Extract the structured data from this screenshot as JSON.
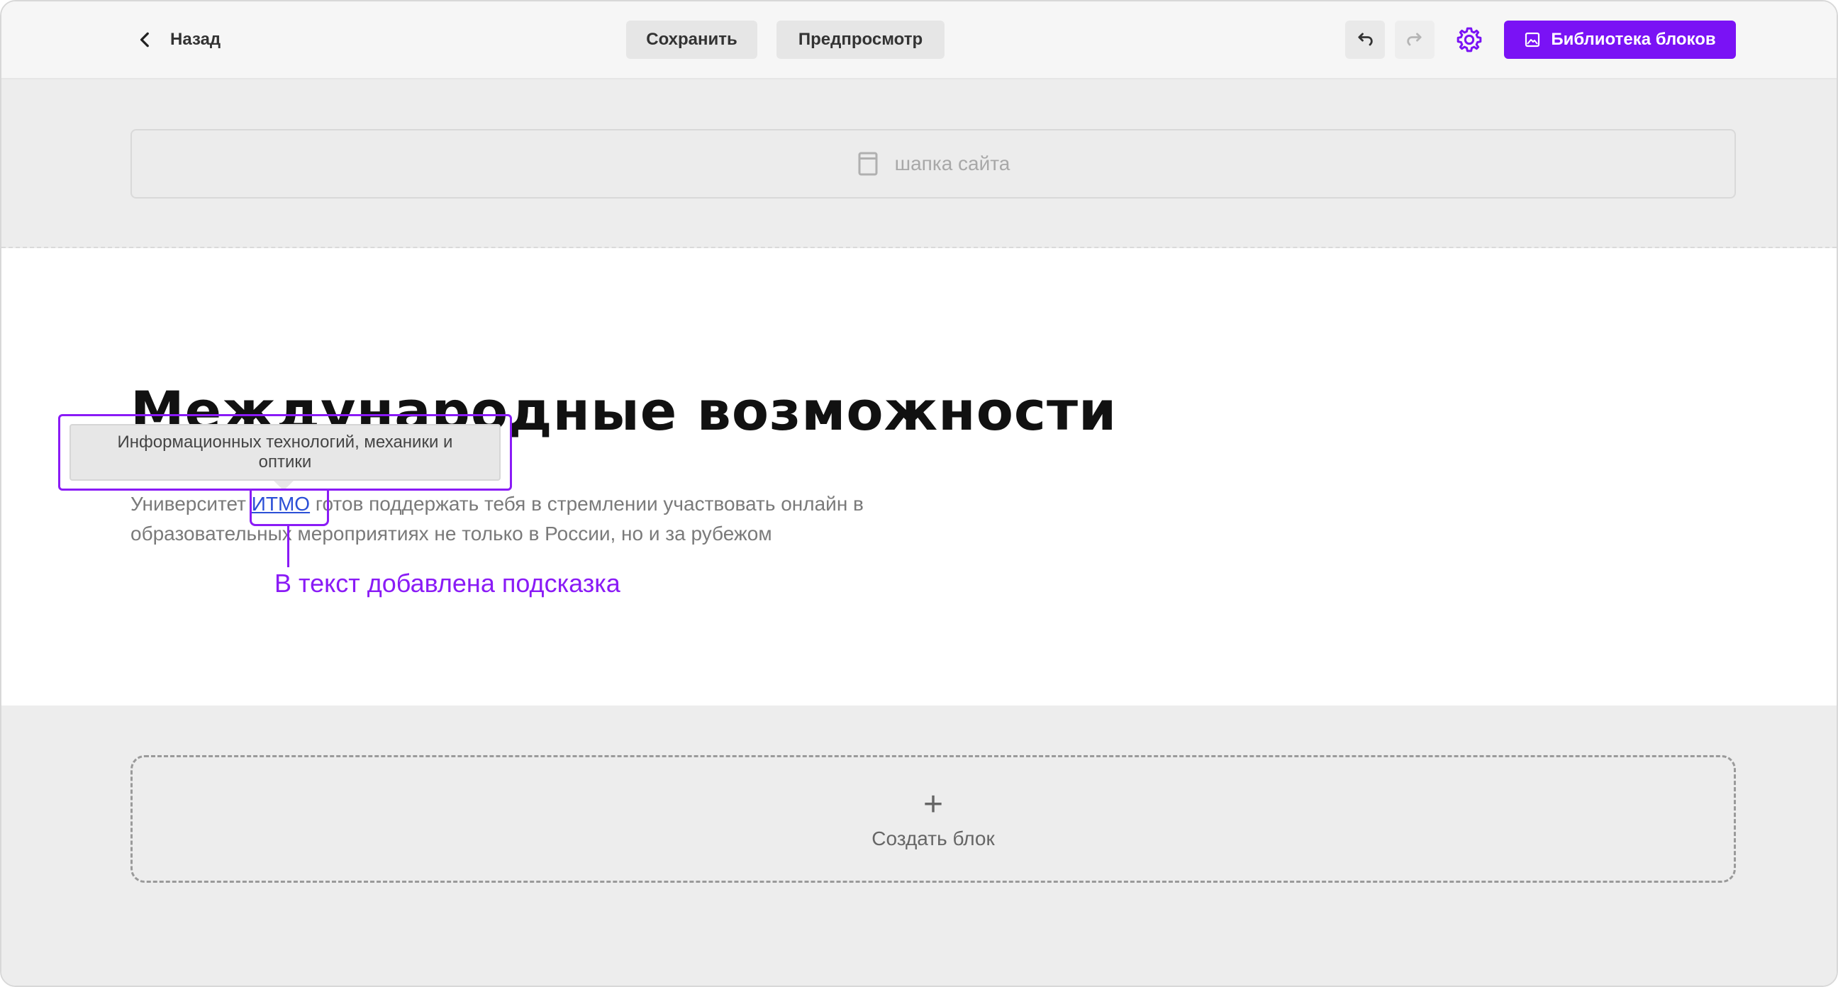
{
  "toolbar": {
    "back_label": "Назад",
    "save_label": "Сохранить",
    "preview_label": "Предпросмотр",
    "library_label": "Библиотека блоков",
    "accent": "#7a12f5"
  },
  "header_block": {
    "label": "шапка сайта",
    "icon": "layout-icon"
  },
  "content": {
    "title": "Международные возможности",
    "para_before": "Университет ",
    "para_link": "ИТМО",
    "para_after_line1": " готов поддержать тебя в стремлении участвовать онлайн в",
    "para_line2": "образовательных мероприятиях не только в России, но и за рубежом",
    "tooltip_text": "Информационных технологий, механики и оптики",
    "annotation": "В текст добавлена подсказка",
    "annotation_color": "#8a1bf6"
  },
  "create_block": {
    "plus": "+",
    "label": "Создать блок"
  }
}
